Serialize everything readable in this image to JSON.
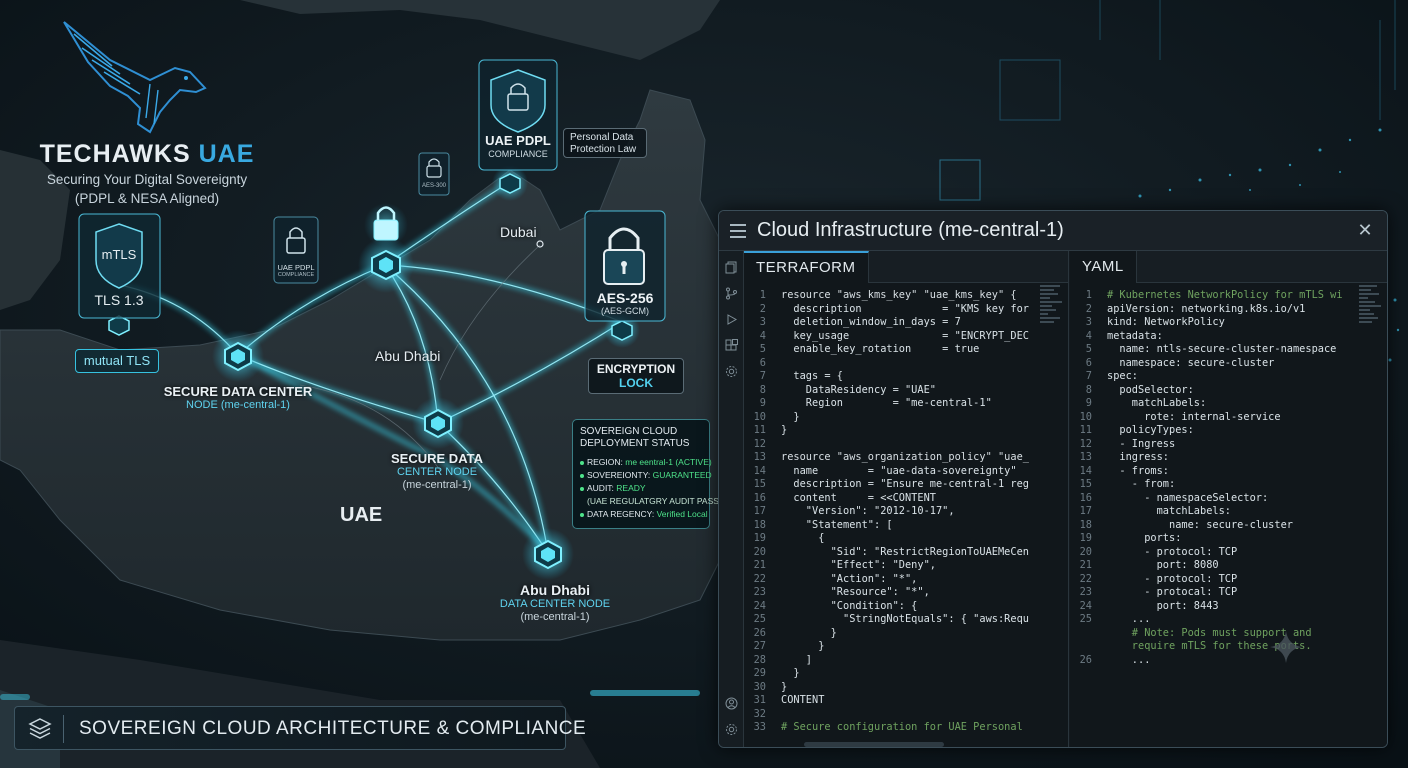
{
  "brand": {
    "name_main": "TECHAWKS",
    "name_accent": "UAE",
    "tagline_1": "Securing Your Digital Sovereignty",
    "tagline_2": "(PDPL & NESA Aligned)"
  },
  "map": {
    "badge_mtls_top": "mTLS",
    "badge_mtls_bottom": "TLS 1.3",
    "mutual_tls": "mutual TLS",
    "small_lock_left_1": "UAE PDPL",
    "small_lock_left_2": "COMPLIANCE",
    "small_lock_top": "AES-300",
    "pdpl_shield_1": "UAE PDPL",
    "pdpl_shield_2": "COMPLIANCE",
    "pdpl_callout_1": "Personal Data",
    "pdpl_callout_2": "Protection Law",
    "aes_1": "AES-256",
    "aes_2": "(AES-GCM)",
    "encryption_1": "ENCRYPTION",
    "encryption_2": "LOCK",
    "city_dubai": "Dubai",
    "city_abu_dhabi": "Abu Dhabi",
    "country": "UAE",
    "node1_title": "SECURE DATA CENTER",
    "node1_sub": "NODE (me-central-1)",
    "node2_title": "SECURE DATA",
    "node2_sub": "CENTER NODE",
    "node2_sub2": "(me-central-1)",
    "node3_title": "Abu Dhabi",
    "node3_sub": "DATA CENTER NODE",
    "node3_sub2": "(me-central-1)"
  },
  "status": {
    "head_1": "SOVEREIGN CLOUD",
    "head_2": "DEPLOYMENT STATUS",
    "rows": [
      {
        "k": "REGION: ",
        "v": "me eentral-1 (ACTIVE)"
      },
      {
        "k": "SOVEREIONTY: ",
        "v": "GUARANTEED"
      },
      {
        "k": "AUDIT: ",
        "v": "READY"
      },
      {
        "k": "",
        "v": "(UAE REGULATGRY AUDIT PASS)"
      },
      {
        "k": "DATA REGENCY: ",
        "v": "Verified Local"
      }
    ]
  },
  "bottom_bar": {
    "label": "SOVEREIGN CLOUD ARCHITECTURE & COMPLIANCE"
  },
  "window": {
    "title": "Cloud Infrastructure (me-central-1)",
    "close": "✕",
    "left_tab": "TERRAFORM",
    "right_tab": "YAML"
  },
  "terraform": [
    {
      "n": "1",
      "t": "resource \"aws_kms_key\" \"uae_kms_key\" {",
      "c": "kw"
    },
    {
      "n": "2",
      "t": "  description             = \"KMS key for",
      "c": ""
    },
    {
      "n": "3",
      "t": "  deletion_window_in_days = 7",
      "c": ""
    },
    {
      "n": "4",
      "t": "  key_usage               = \"ENCRYPT_DEC",
      "c": ""
    },
    {
      "n": "5",
      "t": "  enable_key_rotation     = true",
      "c": ""
    },
    {
      "n": "6",
      "t": "",
      "c": ""
    },
    {
      "n": "7",
      "t": "  tags = {",
      "c": ""
    },
    {
      "n": "8",
      "t": "    DataResidency = \"UAE\"",
      "c": ""
    },
    {
      "n": "9",
      "t": "    Region        = \"me-central-1\"",
      "c": ""
    },
    {
      "n": "10",
      "t": "  }",
      "c": ""
    },
    {
      "n": "11",
      "t": "}",
      "c": ""
    },
    {
      "n": "12",
      "t": "",
      "c": ""
    },
    {
      "n": "13",
      "t": "resource \"aws_organization_policy\" \"uae_",
      "c": "kw"
    },
    {
      "n": "14",
      "t": "  name        = \"uae-data-sovereignty\"",
      "c": ""
    },
    {
      "n": "15",
      "t": "  description = \"Ensure me-central-1 reg",
      "c": ""
    },
    {
      "n": "16",
      "t": "  content     = <<CONTENT",
      "c": ""
    },
    {
      "n": "17",
      "t": "    \"Version\": \"2012-10-17\",",
      "c": ""
    },
    {
      "n": "18",
      "t": "    \"Statement\": [",
      "c": ""
    },
    {
      "n": "19",
      "t": "      {",
      "c": ""
    },
    {
      "n": "20",
      "t": "        \"Sid\": \"RestrictRegionToUAEMeCen",
      "c": ""
    },
    {
      "n": "21",
      "t": "        \"Effect\": \"Deny\",",
      "c": ""
    },
    {
      "n": "22",
      "t": "        \"Action\": \"*\",",
      "c": ""
    },
    {
      "n": "23",
      "t": "        \"Resource\": \"*\",",
      "c": ""
    },
    {
      "n": "24",
      "t": "        \"Condition\": {",
      "c": ""
    },
    {
      "n": "25",
      "t": "          \"StringNotEquals\": { \"aws:Requ",
      "c": ""
    },
    {
      "n": "26",
      "t": "        }",
      "c": ""
    },
    {
      "n": "27",
      "t": "      }",
      "c": ""
    },
    {
      "n": "28",
      "t": "    ]",
      "c": ""
    },
    {
      "n": "29",
      "t": "  }",
      "c": ""
    },
    {
      "n": "30",
      "t": "}",
      "c": ""
    },
    {
      "n": "31",
      "t": "CONTENT",
      "c": ""
    },
    {
      "n": "32",
      "t": "",
      "c": ""
    },
    {
      "n": "33",
      "t": "# Secure configuration for UAE Personal",
      "c": "cm"
    }
  ],
  "yaml": [
    {
      "n": "1",
      "t": "# Kubernetes NetworkPolicy for mTLS wi",
      "c": "cm"
    },
    {
      "n": "2",
      "t": "apiVersion: networking.k8s.io/v1",
      "c": ""
    },
    {
      "n": "3",
      "t": "kind: NetworkPolicy",
      "c": ""
    },
    {
      "n": "4",
      "t": "metadata:",
      "c": ""
    },
    {
      "n": "5",
      "t": "  name: ntls-secure-cluster-namespace",
      "c": ""
    },
    {
      "n": "6",
      "t": "  namespace: secure-cluster",
      "c": ""
    },
    {
      "n": "7",
      "t": "spec:",
      "c": ""
    },
    {
      "n": "8",
      "t": "  podSelector:",
      "c": ""
    },
    {
      "n": "9",
      "t": "    matchLabels:",
      "c": ""
    },
    {
      "n": "10",
      "t": "      rote: internal-service",
      "c": ""
    },
    {
      "n": "11",
      "t": "  policyTypes:",
      "c": ""
    },
    {
      "n": "12",
      "t": "  - Ingress",
      "c": ""
    },
    {
      "n": "13",
      "t": "  ingress:",
      "c": ""
    },
    {
      "n": "14",
      "t": "  - froms:",
      "c": ""
    },
    {
      "n": "15",
      "t": "    - from:",
      "c": ""
    },
    {
      "n": "16",
      "t": "      - namespaceSelector:",
      "c": ""
    },
    {
      "n": "17",
      "t": "        matchLabels:",
      "c": ""
    },
    {
      "n": "18",
      "t": "          name: secure-cluster",
      "c": ""
    },
    {
      "n": "19",
      "t": "      ports:",
      "c": ""
    },
    {
      "n": "20",
      "t": "      - protocol: TCP",
      "c": ""
    },
    {
      "n": "21",
      "t": "        port: 8080",
      "c": ""
    },
    {
      "n": "22",
      "t": "      - protocol: TCP",
      "c": ""
    },
    {
      "n": "23",
      "t": "      - protocal: TCP",
      "c": ""
    },
    {
      "n": "24",
      "t": "        port: 8443",
      "c": ""
    },
    {
      "n": "25",
      "t": "    ...",
      "c": ""
    },
    {
      "n": "",
      "t": "    # Note: Pods must support and",
      "c": "cm"
    },
    {
      "n": "",
      "t": "    require mTLS for these ports.",
      "c": "cm"
    },
    {
      "n": "26",
      "t": "    ...",
      "c": ""
    }
  ],
  "colors": {
    "accent": "#39a9e0",
    "glow": "#36d6f0",
    "status_ok": "#4ee38a",
    "window_bg": "#141a1f"
  }
}
